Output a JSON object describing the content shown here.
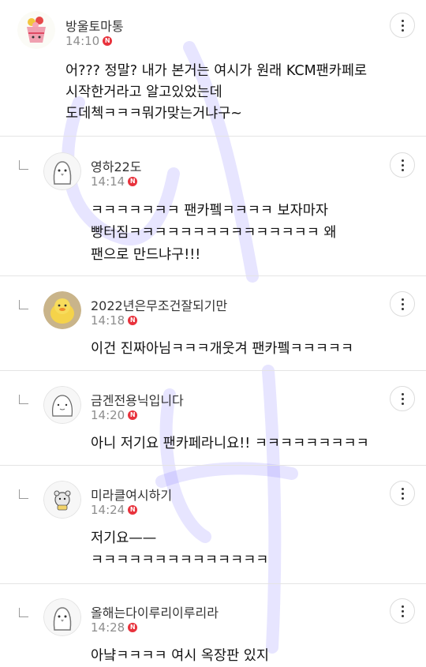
{
  "comments": [
    {
      "nickname": "방울토마통",
      "time": "14:10",
      "badge": "N",
      "avatar": "tomato-cup-avatar",
      "reply": false,
      "lines": [
        "어??? 정말? 내가 본거는 여시가 원래 KCM팬카페로",
        "시작한거라고 알고있었는데",
        "도데첵ㅋㅋㅋ뭐가맞는거냐구~"
      ]
    },
    {
      "nickname": "영하22도",
      "time": "14:14",
      "badge": "N",
      "avatar": "grey-penguin-avatar",
      "reply": true,
      "lines": [
        "ㅋㅋㅋㅋㅋㅋㅋ 팬카펰ㅋㅋㅋㅋ 보자마자",
        "빵터짐ㅋㅋㅋㅋㅋㅋㅋㅋㅋㅋㅋㅋㅋㅋㅋ 왜",
        "팬으로 만드냐구!!!"
      ]
    },
    {
      "nickname": "2022년은무조건잘되기만",
      "time": "14:18",
      "badge": "N",
      "avatar": "yellow-duck-avatar",
      "reply": true,
      "lines": [
        "이건 진짜아님ㅋㅋㅋ개웃겨 팬카펰ㅋㅋㅋㅋㅋ"
      ]
    },
    {
      "nickname": "금겐전용닉입니다",
      "time": "14:20",
      "badge": "N",
      "avatar": "sketch-face-avatar",
      "reply": true,
      "lines": [
        "아니 저기요 팬카페라니요!! ㅋㅋㅋㅋㅋㅋㅋㅋㅋ"
      ]
    },
    {
      "nickname": "미라클여시하기",
      "time": "14:24",
      "badge": "N",
      "avatar": "small-animal-avatar",
      "reply": true,
      "lines": [
        "저기요——",
        "ㅋㅋㅋㅋㅋㅋㅋㅋㅋㅋㅋㅋㅋㅋ"
      ]
    },
    {
      "nickname": "올해는다이루리이루리라",
      "time": "14:28",
      "badge": "N",
      "avatar": "grey-penguin-avatar",
      "reply": true,
      "lines": [
        "아냨ㅋㅋㅋㅋ 여시 옥장판 있지"
      ]
    }
  ],
  "colors": {
    "badge": "#e8323c",
    "meta": "#8e8e8e",
    "divider": "#e4e4e4",
    "watermark": "#6b5cff"
  }
}
